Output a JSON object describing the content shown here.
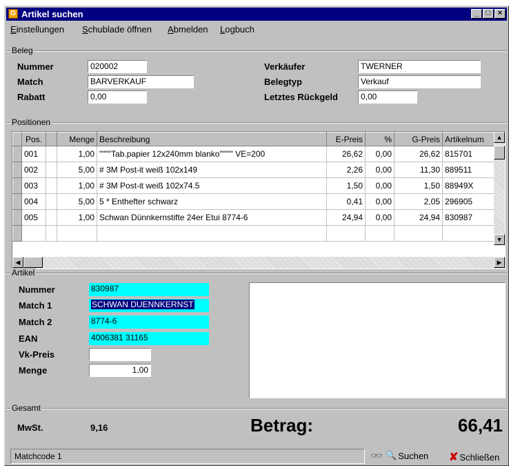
{
  "window": {
    "title": "Artikel suchen",
    "min_label": "_",
    "max_label": "□",
    "close_label": "×"
  },
  "menu": [
    {
      "label": "Einstellungen",
      "accel": "E",
      "rest": "instellungen"
    },
    {
      "label": "Schublade öffnen",
      "accel": "S",
      "rest": "chublade öffnen"
    },
    {
      "label": "Abmelden",
      "accel": "A",
      "rest": "bmelden"
    },
    {
      "label": "Logbuch",
      "accel": "L",
      "rest": "ogbuch"
    }
  ],
  "beleg": {
    "group_label": "Beleg",
    "nummer_label": "Nummer",
    "nummer": "020002",
    "match_label": "Match",
    "match": "BARVERKAUF",
    "rabatt_label": "Rabatt",
    "rabatt": "0,00",
    "verkaeufer_label": "Verkäufer",
    "verkaeufer": "TWERNER",
    "belegtyp_label": "Belegtyp",
    "belegtyp": "Verkauf",
    "rueckgeld_label": "Letztes Rückgeld",
    "rueckgeld": "0,00"
  },
  "positionen": {
    "group_label": "Positionen",
    "columns": [
      "Pos.",
      "Menge",
      "Beschreibung",
      "E-Preis",
      "%",
      "G-Preis",
      "Artikelnum"
    ],
    "rows": [
      [
        "001",
        "1,00",
        "\"\"\"\"Tab.papier 12x240mm blanko\"\"\"\"' VE=200",
        "26,62",
        "0,00",
        "26,62",
        "815701"
      ],
      [
        "002",
        "5,00",
        "# 3M Post-it weiß 102x149",
        "2,26",
        "0,00",
        "11,30",
        "889511"
      ],
      [
        "003",
        "1,00",
        "# 3M Post-it weiß 102x74.5",
        "1,50",
        "0,00",
        "1,50",
        "88949X"
      ],
      [
        "004",
        "5,00",
        "5 * Enthefter schwarz",
        "0,41",
        "0,00",
        "2,05",
        "296905"
      ],
      [
        "005",
        "1,00",
        "Schwan Dünnkernstifte 24er Etui  8774-6",
        "24,94",
        "0,00",
        "24,94",
        "830987"
      ]
    ]
  },
  "artikel": {
    "group_label": "Artikel",
    "nummer_label": "Nummer",
    "nummer": "830987",
    "match1_label": "Match 1",
    "match1": "SCHWAN DUENNKERNST",
    "match2_label": "Match 2",
    "match2": "8774-6",
    "ean_label": "EAN",
    "ean": "4006381 31165",
    "vkpreis_label": "Vk-Preis",
    "vkpreis": "",
    "menge_label": "Menge",
    "menge": "1,00"
  },
  "gesamt": {
    "group_label": "Gesamt",
    "mwst_label": "MwSt.",
    "mwst": "9,16",
    "betrag_label": "Betrag:",
    "betrag": "66,41"
  },
  "status": {
    "text": "Matchcode 1"
  },
  "toolbar": {
    "suchen": "Suchen",
    "schliessen": "Schließen"
  },
  "colors": {
    "titlebar": "#000080",
    "face": "#c0c0c0",
    "highlight_field": "#00ffff"
  }
}
